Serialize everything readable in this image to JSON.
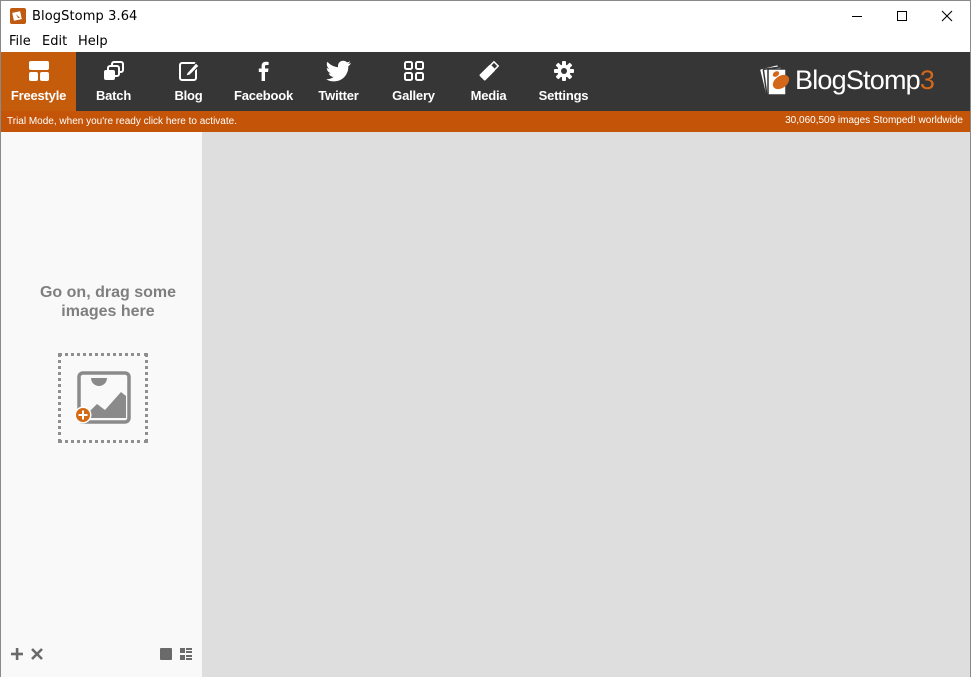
{
  "window": {
    "title": "BlogStomp 3.64",
    "controls": [
      "minimize",
      "maximize",
      "close"
    ]
  },
  "menu": {
    "items": [
      "File",
      "Edit",
      "Help"
    ]
  },
  "toolbar": {
    "tabs": [
      {
        "label": "Freestyle",
        "icon": "freestyle-icon",
        "active": true
      },
      {
        "label": "Batch",
        "icon": "batch-icon",
        "active": false
      },
      {
        "label": "Blog",
        "icon": "blog-edit-icon",
        "active": false
      },
      {
        "label": "Facebook",
        "icon": "facebook-icon",
        "active": false
      },
      {
        "label": "Twitter",
        "icon": "twitter-icon",
        "active": false
      },
      {
        "label": "Gallery",
        "icon": "gallery-grid-icon",
        "active": false
      },
      {
        "label": "Media",
        "icon": "media-usb-icon",
        "active": false
      },
      {
        "label": "Settings",
        "icon": "gear-icon",
        "active": false
      }
    ],
    "logo": {
      "name": "BlogStomp",
      "version": "3"
    }
  },
  "trial": {
    "message": "Trial Mode, when you're ready click here to activate.",
    "stat": "30,060,509 images Stomped! worldwide"
  },
  "left_panel": {
    "drop_prompt_line1": "Go on, drag some",
    "drop_prompt_line2": "images here",
    "bottom_controls": [
      "add-icon",
      "remove-icon",
      "single-view-icon",
      "list-view-icon"
    ]
  },
  "colors": {
    "accent": "#c45c0c",
    "toolbar_bg": "#363636",
    "trial_bar": "#c45508",
    "main_bg": "#dedede",
    "panel_bg": "#f9f9f9"
  }
}
